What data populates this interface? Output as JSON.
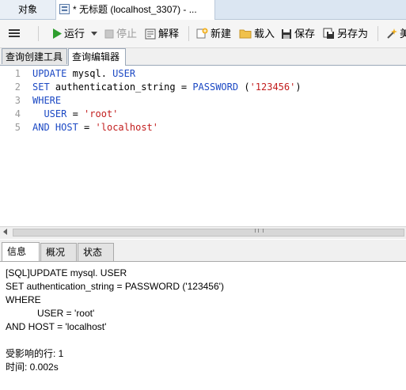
{
  "tabs": {
    "objects": "对象",
    "query": "* 无标题 (localhost_3307) - ..."
  },
  "toolbar": {
    "run": "运行",
    "stop": "停止",
    "explain": "解释",
    "new": "新建",
    "load": "载入",
    "save": "保存",
    "save_as": "另存为",
    "beautify_partial": "美"
  },
  "subtabs": {
    "query_builder": "查询创建工具",
    "query_editor": "查询编辑器"
  },
  "editor": {
    "lines": [
      {
        "num": "1",
        "tokens": [
          {
            "t": "UPDATE",
            "c": "kw"
          },
          {
            "t": " mysql. ",
            "c": ""
          },
          {
            "t": "USER",
            "c": "kw"
          }
        ]
      },
      {
        "num": "2",
        "tokens": [
          {
            "t": "SET",
            "c": "kw"
          },
          {
            "t": " authentication_string = ",
            "c": ""
          },
          {
            "t": "PASSWORD",
            "c": "kw"
          },
          {
            "t": " (",
            "c": ""
          },
          {
            "t": "'123456'",
            "c": "str"
          },
          {
            "t": ")",
            "c": ""
          }
        ]
      },
      {
        "num": "3",
        "tokens": [
          {
            "t": "WHERE",
            "c": "kw"
          }
        ]
      },
      {
        "num": "4",
        "tokens": [
          {
            "t": "  USER",
            "c": "kw"
          },
          {
            "t": " = ",
            "c": ""
          },
          {
            "t": "'root'",
            "c": "str"
          }
        ]
      },
      {
        "num": "5",
        "tokens": [
          {
            "t": "AND",
            "c": "kw"
          },
          {
            "t": " ",
            "c": ""
          },
          {
            "t": "HOST",
            "c": "kw"
          },
          {
            "t": " = ",
            "c": ""
          },
          {
            "t": "'localhost'",
            "c": "str"
          }
        ]
      }
    ]
  },
  "panel_tabs": {
    "info": "信息",
    "overview": "概况",
    "status": "状态"
  },
  "messages": [
    "[SQL]UPDATE mysql. USER",
    "SET authentication_string = PASSWORD ('123456')",
    "WHERE",
    "            USER = 'root'",
    "AND HOST = 'localhost'",
    "",
    "受影响的行: 1",
    "时间: 0.002s"
  ],
  "colors": {
    "keyword": "#1c49c4",
    "string": "#c21d1d",
    "run_icon": "#2e9e2e"
  },
  "icons": [
    "menu-icon",
    "query-tab-icon",
    "run-icon",
    "dropdown-arrow-icon",
    "stop-icon",
    "explain-icon",
    "new-query-icon",
    "load-folder-icon",
    "save-icon",
    "save-as-icon",
    "beautify-wand-icon"
  ]
}
